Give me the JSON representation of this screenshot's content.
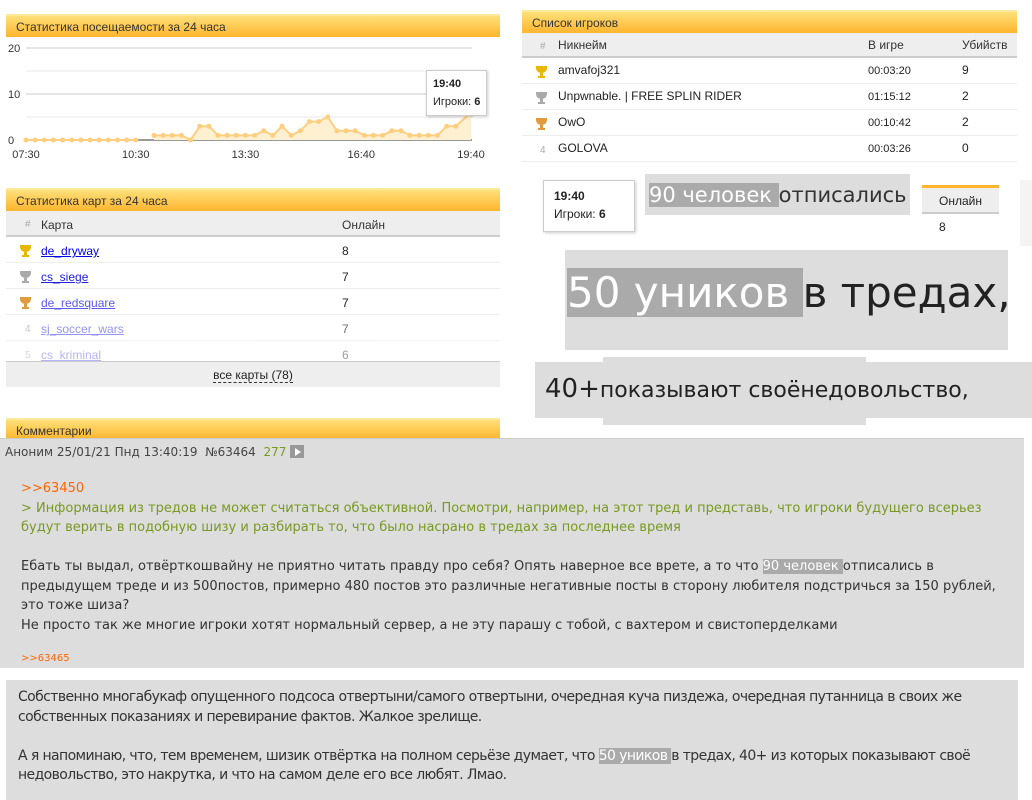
{
  "attendance": {
    "title": "Статистика посещаемости за 24 часа",
    "tooltip": {
      "time": "19:40",
      "label": "Игроки:",
      "value": "6"
    }
  },
  "chart_data": {
    "type": "area",
    "title": "",
    "xlabel": "",
    "ylabel": "",
    "ylim": [
      0,
      20
    ],
    "yticks": [
      "0",
      "10",
      "20"
    ],
    "xticks": [
      "07:30",
      "10:30",
      "13:30",
      "16:40",
      "19:40"
    ],
    "grid": true,
    "color": "#ffcf7f",
    "series": [
      {
        "x": [
          "07:30",
          "07:45",
          "08:00",
          "08:15",
          "08:30",
          "08:45",
          "09:00",
          "09:15",
          "09:30",
          "09:45",
          "10:00",
          "10:15",
          "10:30",
          "11:00",
          "11:15",
          "11:30",
          "11:45",
          "12:00",
          "12:15",
          "12:30",
          "12:45",
          "13:00",
          "13:15",
          "13:30",
          "13:45",
          "14:00",
          "14:15",
          "14:30",
          "14:45",
          "15:00",
          "15:15",
          "15:30",
          "15:45",
          "16:00",
          "16:15",
          "16:30",
          "16:45",
          "17:00",
          "17:15",
          "17:30",
          "17:45",
          "18:00",
          "18:15",
          "18:30",
          "18:45",
          "19:00",
          "19:15",
          "19:40"
        ],
        "y": [
          0,
          0,
          0,
          0,
          0,
          0,
          0,
          0,
          0,
          0,
          0,
          0,
          0,
          1,
          1,
          1,
          1,
          0,
          3,
          3,
          1,
          1,
          1,
          1,
          1,
          2,
          1,
          3,
          1,
          2,
          4,
          4,
          5,
          2,
          2,
          2,
          1,
          1,
          1,
          2,
          2,
          1,
          1,
          1,
          1,
          3,
          3,
          6
        ]
      }
    ]
  },
  "maps": {
    "title": "Статистика карт за 24 часа",
    "col_num": "#",
    "col_map": "Карта",
    "col_online": "Онлайн",
    "rows": [
      {
        "rank": "1",
        "name": "de_dryway",
        "online": "8"
      },
      {
        "rank": "2",
        "name": "cs_siege",
        "online": "7"
      },
      {
        "rank": "3",
        "name": "de_redsquare",
        "online": "7"
      },
      {
        "rank": "4",
        "name": "sj_soccer_wars",
        "online": "7"
      },
      {
        "rank": "5",
        "name": "cs_kriminal",
        "online": "6"
      }
    ],
    "all_link": "все карты (78)"
  },
  "comments": {
    "title": "Комментарии"
  },
  "players": {
    "title": "Список игроков",
    "col_num": "#",
    "col_nick": "Никнейм",
    "col_time": "В игре",
    "col_kills": "Убийств",
    "rows": [
      {
        "rank": "1",
        "nick": "amvafoj321",
        "time": "00:03:20",
        "kills": "9"
      },
      {
        "rank": "2",
        "nick": "Unpwnable. | FREE SPLIN RIDER",
        "time": "01:15:12",
        "kills": "2"
      },
      {
        "rank": "3",
        "nick": "OwO",
        "time": "00:10:42",
        "kills": "2"
      },
      {
        "rank": "4",
        "nick": "GOLOVA",
        "time": "00:03:26",
        "kills": "0"
      }
    ]
  },
  "collage": {
    "tooltip_time": "19:40",
    "tooltip_label": "Игроки:",
    "tooltip_value": "6",
    "hl90": "90 человек ",
    "rest90": "отписались",
    "online_head": "Онлайн",
    "online_val": "8",
    "hl50": "50 уников ",
    "rest50": "в тредах,",
    "t40a": "40+",
    "t40b": "показывают своё",
    "t40c": "недовольство,"
  },
  "post1": {
    "author": "Аноним",
    "date": "25/01/21 Пнд 13:40:19",
    "number": "№63464",
    "count": "277",
    "reply_ref": ">>63450",
    "quote": "> Информация из тредов не может считаться объективной. Посмотри, например, на этот тред и представь, что игроки будущего всерьез будут верить в подобную шизу и разбирать то, что было насрано в тредах за последнее время",
    "p1a": "Ебать ты выдал, отвёрткошвайну не приятно читать правду про себя? Опять наверное все врете, а то что ",
    "p1hl": "90 человек ",
    "p1b": "отписались в предыдущем треде и из 500постов, примерно 480 постов это различные негативные посты в сторону любителя подстричься за 150 рублей, это тоже шиза?",
    "p2": "Не просто так же многие игроки хотят нормальный сервер, а не эту парашу с тобой, с вахтером и свистоперделками",
    "backlink": ">>63465"
  },
  "post2": {
    "p1": "Собственно многабукаф опущенного подсоса отвертыни/самого отвертыни, очередная куча пиздежа, очередная путанница в своих же собственных показаниях и перевирание фактов. Жалкое зрелище.",
    "p2a": "А я напоминаю, что, тем временем, шизик отвёртка на полном серьёзе думает, что ",
    "p2hl": "50 уников ",
    "p2b": "в тредах, 40+ из которых показывают своё недовольство, это накрутка, и что на самом деле его все любят. Лмао."
  }
}
